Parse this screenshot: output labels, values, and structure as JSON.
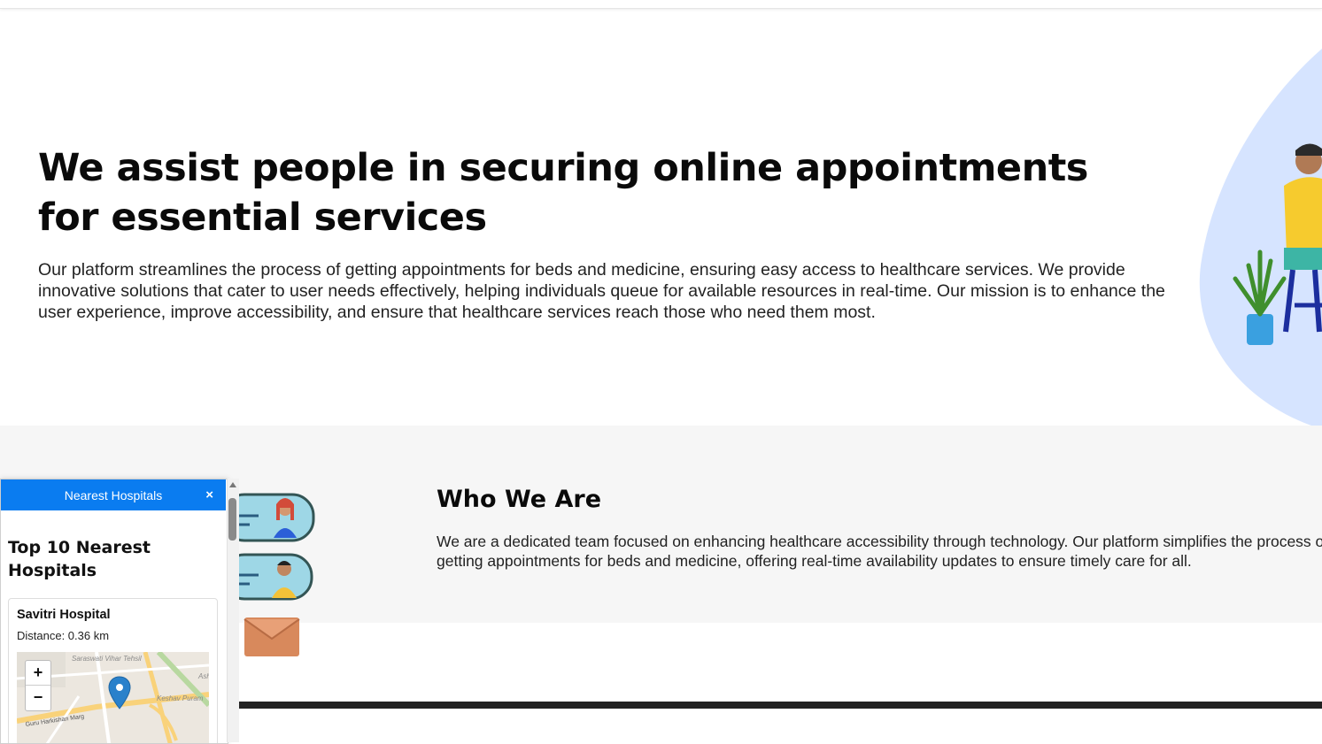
{
  "hero": {
    "title": "We assist people in securing online appointments for essential services",
    "text": "Our platform streamlines the process of getting appointments for beds and medicine, ensuring easy access to healthcare services. We provide innovative solutions that cater to user needs effectively, helping individuals queue for available resources in real-time. Our mission is to enhance the user experience, improve accessibility, and ensure that healthcare services reach those who need them most."
  },
  "who": {
    "title": "Who We Are",
    "text": "We are a dedicated team focused on enhancing healthcare accessibility through technology. Our platform simplifies the process of getting appointments for beds and medicine, offering real-time availability updates to ensure timely care for all."
  },
  "popup": {
    "header": "Nearest Hospitals",
    "close": "×",
    "heading": "Top 10 Nearest Hospitals",
    "hospitals": [
      {
        "name": "Savitri Hospital",
        "distance": "Distance: 0.36 km"
      }
    ],
    "map": {
      "zoom_in": "+",
      "zoom_out": "−",
      "labels": [
        "Saraswati Vihar Tehsil",
        "Keshav Puram",
        "Guru Harkishan Marg",
        "Ash"
      ]
    }
  },
  "colors": {
    "accent": "#0a7cf0",
    "blob": "#d6e4ff"
  },
  "icons": [
    "close-icon",
    "map-marker-icon",
    "envelope-icon",
    "zoom-in-icon",
    "zoom-out-icon"
  ]
}
